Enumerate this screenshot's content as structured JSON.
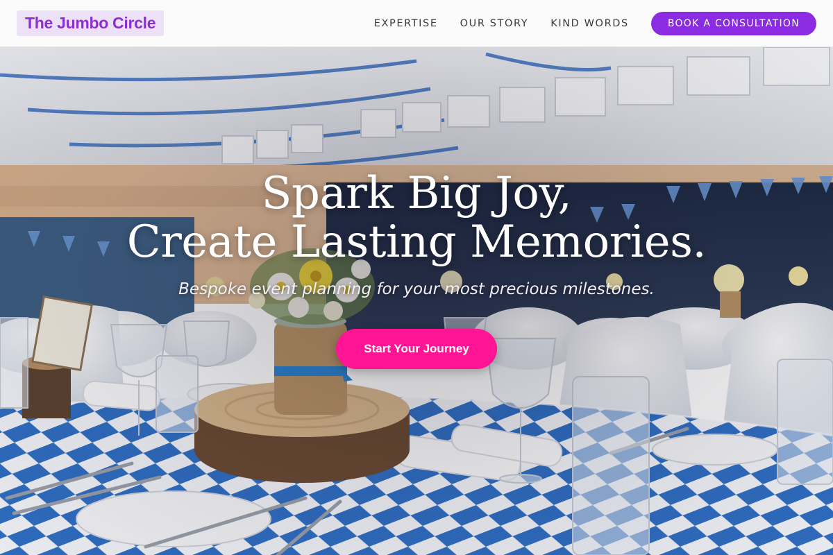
{
  "brand": {
    "logo_text": "The Jumbo Circle",
    "accent": "#8b2be2",
    "logo_bg": "#ede1f7"
  },
  "nav": {
    "links": [
      "EXPERTISE",
      "OUR STORY",
      "KIND WORDS"
    ],
    "cta_label": "BOOK A CONSULTATION"
  },
  "hero": {
    "title_line1": "Spark Big Joy,",
    "title_line2": "Create Lasting Memories.",
    "subtitle": "Bespoke event planning for your most precious milestones.",
    "button_label": "Start Your Journey",
    "button_color": "#ff1493",
    "background_image": "banquet hall with blue and white checkered tablecloths, burlap jar centerpieces on log slices, bunting flags"
  }
}
